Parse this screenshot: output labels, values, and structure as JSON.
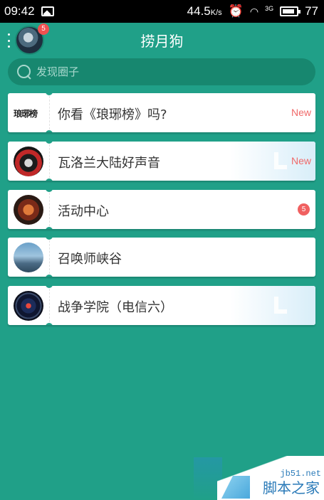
{
  "status_bar": {
    "time": "09:42",
    "signal_text": "44.5",
    "network_type": "3G",
    "battery": "77",
    "icons": [
      "image-icon",
      "alarm-icon",
      "wifi-icon",
      "signal-icon",
      "battery-icon"
    ]
  },
  "header": {
    "title": "捞月狗",
    "avatar_badge": "5"
  },
  "search": {
    "placeholder": "发现圈子"
  },
  "circles": [
    {
      "label": "你看《琅琊榜》吗?",
      "tag": "New",
      "thumb_text": "琅琊榜"
    },
    {
      "label": "瓦洛兰大陆好声音",
      "tag": "New"
    },
    {
      "label": "活动中心",
      "badge": "5"
    },
    {
      "label": "召唤师峡谷"
    },
    {
      "label": "战争学院（电信六）"
    }
  ],
  "watermark": {
    "url": "jb51.net",
    "text": "脚本之家"
  },
  "colors": {
    "background": "#20a088",
    "search_bg": "#17876f",
    "new_tag": "#f06a6a",
    "badge": "#f05050"
  }
}
